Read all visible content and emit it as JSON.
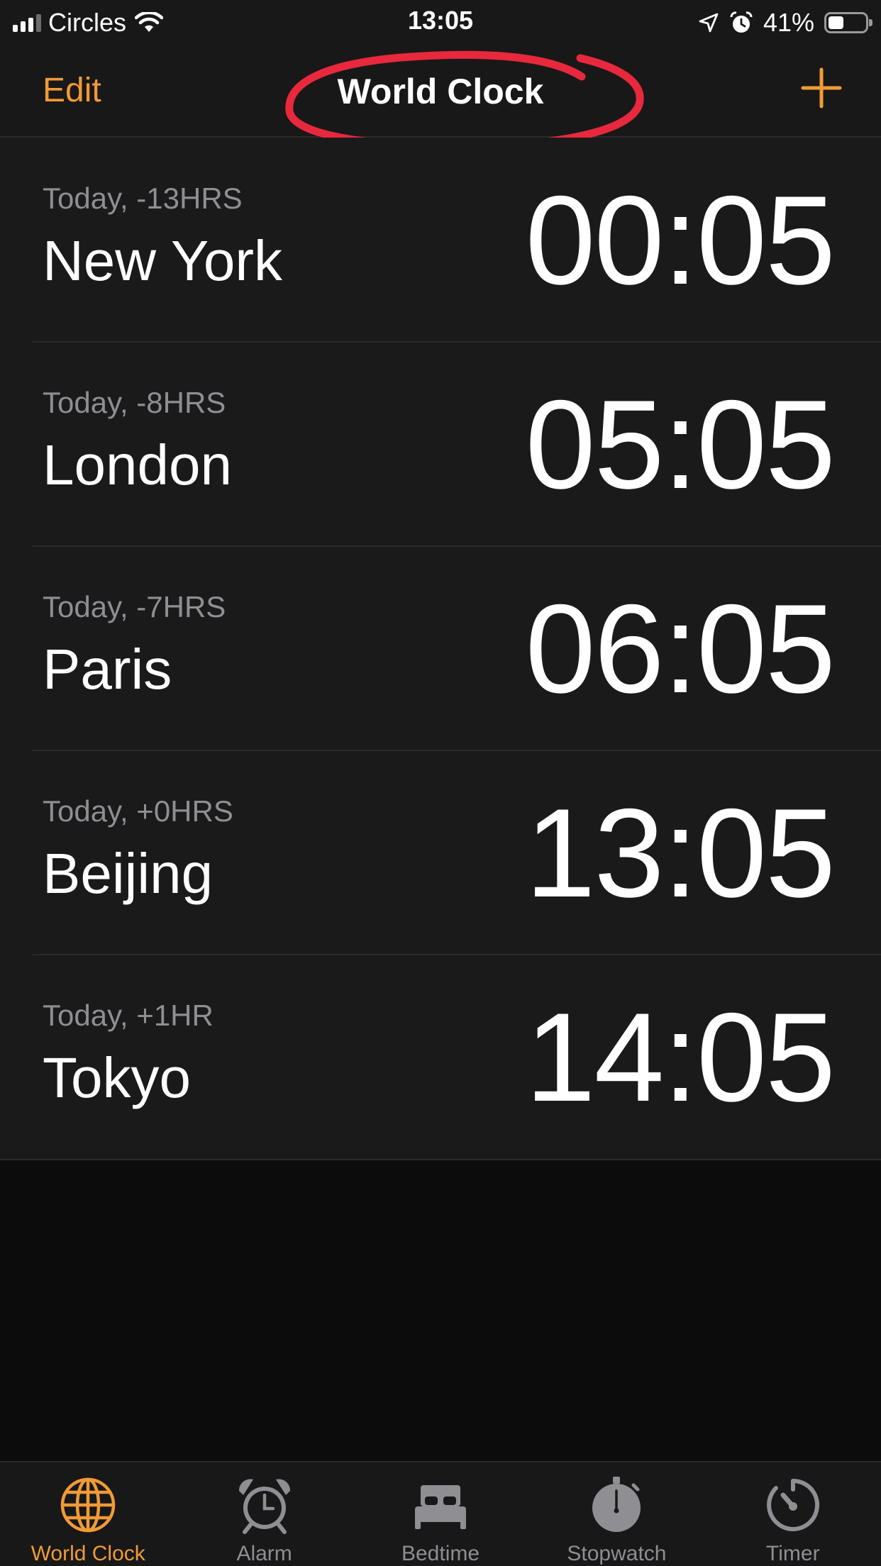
{
  "status_bar": {
    "carrier": "Circles",
    "time": "13:05",
    "battery": "41%",
    "battery_level": 0.41
  },
  "nav": {
    "edit_label": "Edit",
    "title": "World Clock",
    "add_icon": "plus-icon",
    "accent_color": "#f09a37",
    "highlight_color": "#e8283d"
  },
  "clocks": [
    {
      "offset": "Today, -13HRS",
      "city": "New York",
      "time": "00:05"
    },
    {
      "offset": "Today, -8HRS",
      "city": "London",
      "time": "05:05"
    },
    {
      "offset": "Today, -7HRS",
      "city": "Paris",
      "time": "06:05"
    },
    {
      "offset": "Today, +0HRS",
      "city": "Beijing",
      "time": "13:05"
    },
    {
      "offset": "Today, +1HR",
      "city": "Tokyo",
      "time": "14:05"
    }
  ],
  "tabs": [
    {
      "label": "World Clock",
      "icon": "globe-icon",
      "active": true
    },
    {
      "label": "Alarm",
      "icon": "alarm-clock-icon",
      "active": false
    },
    {
      "label": "Bedtime",
      "icon": "bed-icon",
      "active": false
    },
    {
      "label": "Stopwatch",
      "icon": "stopwatch-icon",
      "active": false
    },
    {
      "label": "Timer",
      "icon": "timer-icon",
      "active": false
    }
  ]
}
